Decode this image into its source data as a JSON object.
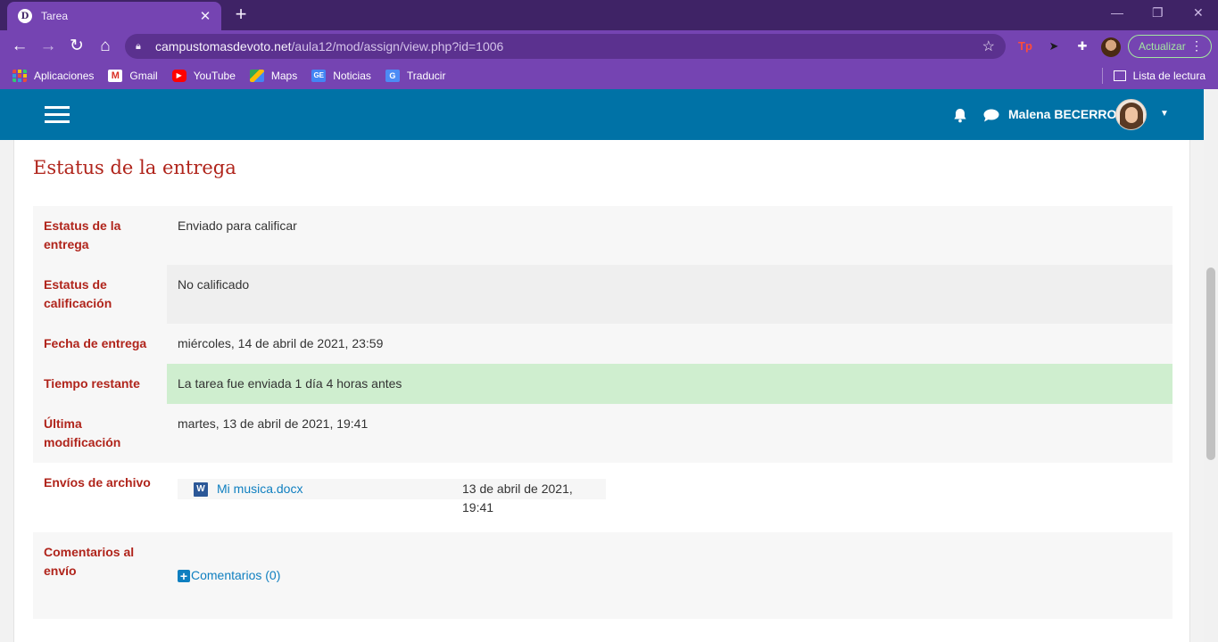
{
  "browser": {
    "tab_title": "Tarea",
    "tab_favicon_letter": "D",
    "url_host": "campustomasdevoto.net",
    "url_path": "/aula12/mod/assign/view.php?id=1006",
    "update_label": "Actualizar",
    "reading_list_label": "Lista de lectura",
    "extension_tp": "Tp",
    "bookmarks": [
      {
        "label": "Aplicaciones",
        "icon": "apps-grid-icon"
      },
      {
        "label": "Gmail",
        "icon": "gmail-icon"
      },
      {
        "label": "YouTube",
        "icon": "youtube-icon"
      },
      {
        "label": "Maps",
        "icon": "maps-icon"
      },
      {
        "label": "Noticias",
        "icon": "news-icon"
      },
      {
        "label": "Traducir",
        "icon": "translate-icon"
      }
    ]
  },
  "navbar": {
    "user_name": "Malena BECERRO"
  },
  "main": {
    "section_title": "Estatus de la entrega",
    "rows": {
      "submission_status": {
        "label": "Estatus de la entrega",
        "value": "Enviado para calificar"
      },
      "grading_status": {
        "label": "Estatus de calificación",
        "value": "No calificado"
      },
      "due_date": {
        "label": "Fecha de entrega",
        "value": "miércoles, 14 de abril de 2021, 23:59"
      },
      "time_remaining": {
        "label": "Tiempo restante",
        "value": "La tarea fue enviada 1 día 4 horas antes"
      },
      "last_modified": {
        "label": "Última modificación",
        "value": "martes, 13 de abril de 2021, 19:41"
      },
      "file_submissions": {
        "label": "Envíos de archivo",
        "file_name": "Mi musica.docx",
        "file_date": "13 de abril de 2021, 19:41",
        "file_icon_letter": "W"
      },
      "submission_comments": {
        "label": "Comentarios al envío",
        "link": "Comentarios (0)"
      }
    }
  },
  "colors": {
    "browser_frame": "#3f2366",
    "browser_toolbar": "#7544b2",
    "navbar": "#0072a6",
    "label_red": "#b0241b",
    "link_blue": "#0f7fc0",
    "success_green": "#cfeecf"
  }
}
